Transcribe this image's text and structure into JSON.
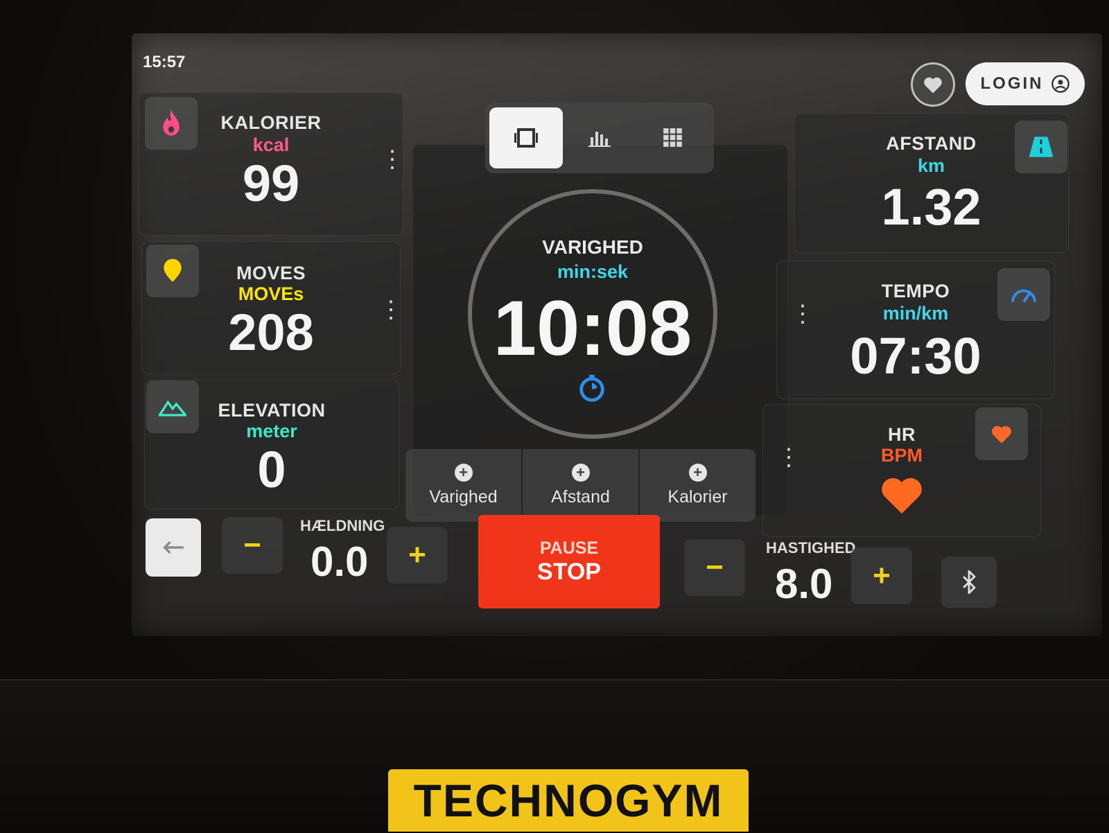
{
  "status": {
    "time": "15:57"
  },
  "header": {
    "login_label": "LOGIN"
  },
  "tiles": {
    "kalorier": {
      "title": "KALORIER",
      "unit": "kcal",
      "value": "99",
      "unit_color": "#ff5a8a"
    },
    "moves": {
      "title": "MOVES",
      "unit": "MOVEs",
      "value": "208",
      "unit_color": "#ffe600"
    },
    "elevation": {
      "title": "ELEVATION",
      "unit": "meter",
      "value": "0",
      "unit_color": "#3fe8c8"
    },
    "afstand": {
      "title": "AFSTAND",
      "unit": "km",
      "value": "1.32",
      "unit_color": "#3fd7e8"
    },
    "tempo": {
      "title": "TEMPO",
      "unit": "min/km",
      "value": "07:30",
      "unit_color": "#3fd7e8"
    },
    "hr": {
      "title": "HR",
      "unit": "BPM",
      "unit_color": "#ff5a2a"
    }
  },
  "center": {
    "title": "VARIGHED",
    "unit": "min:sek",
    "value": "10:08",
    "add_buttons": [
      "Varighed",
      "Afstand",
      "Kalorier"
    ]
  },
  "controls": {
    "incline": {
      "label": "HÆLDNING",
      "value": "0.0",
      "minus": "−",
      "plus": "+"
    },
    "speed": {
      "label": "HASTIGHED",
      "value": "8.0",
      "minus": "−",
      "plus": "+"
    },
    "pause_label": "PAUSE",
    "stop_label": "STOP"
  },
  "brand": {
    "logo_text": "TECHNOGYM"
  },
  "icons": [
    "fire-icon",
    "moves-icon",
    "mountain-icon",
    "road-icon",
    "speedometer-icon",
    "heart-icon",
    "heart-outline-icon",
    "user-icon",
    "stopwatch-icon",
    "arrow-left-icon",
    "bluetooth-icon",
    "single-view-icon",
    "bar-chart-icon",
    "grid-icon"
  ]
}
